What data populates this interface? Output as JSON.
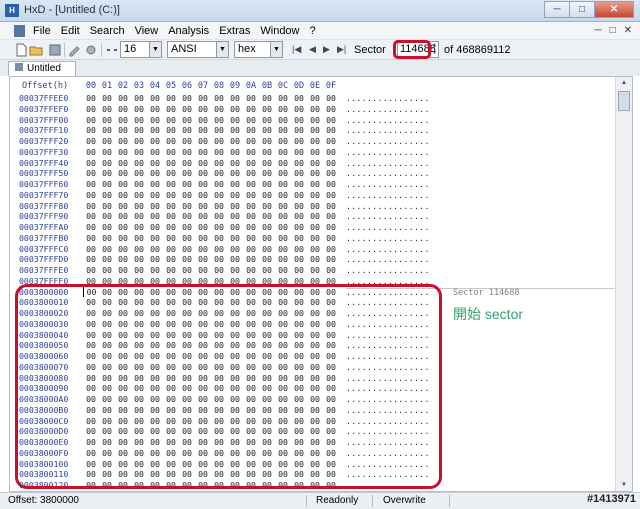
{
  "window": {
    "title": "HxD - [Untitled (C:)]",
    "controls": [
      "─",
      "□",
      "✕"
    ]
  },
  "menu": {
    "items": [
      "File",
      "Edit",
      "Search",
      "View",
      "Analysis",
      "Extras",
      "Window",
      "?"
    ],
    "mdi_controls": [
      "─",
      "□",
      "✕"
    ]
  },
  "toolbar": {
    "bytes_per_row": "16",
    "charset": "ANSI",
    "offset_base": "hex",
    "sector_label": "Sector",
    "sector_value": "114688",
    "sector_total": "of 468869112"
  },
  "tab": {
    "label": "Untitled (C:)"
  },
  "editor": {
    "offset_header": "Offset(h)",
    "column_headers": [
      "00",
      "01",
      "02",
      "03",
      "04",
      "05",
      "06",
      "07",
      "08",
      "09",
      "0A",
      "0B",
      "0C",
      "0D",
      "0E",
      "0F"
    ],
    "byte_value": "00",
    "ascii_value": "................",
    "rows": [
      "00037FFEE0",
      "00037FFEF0",
      "00037FFF00",
      "00037FFF10",
      "00037FFF20",
      "00037FFF30",
      "00037FFF40",
      "00037FFF50",
      "00037FFF60",
      "00037FFF70",
      "00037FFF80",
      "00037FFF90",
      "00037FFFA0",
      "00037FFFB0",
      "00037FFFC0",
      "00037FFFD0",
      "00037FFFE0",
      "00037FFFF0",
      "0003800000",
      "0003800010",
      "0003800020",
      "0003800030",
      "0003800040",
      "0003800050",
      "0003800060",
      "0003800070",
      "0003800080",
      "0003800090",
      "00038000A0",
      "00038000B0",
      "00038000C0",
      "00038000D0",
      "00038000E0",
      "00038000F0",
      "0003800100",
      "0003800110",
      "0003800120"
    ],
    "sector_note": "Sector 114688",
    "annotation": "開始 sector"
  },
  "status": {
    "offset": "Offset: 3800000",
    "mode": "Readonly",
    "insert_mode": "Overwrite"
  },
  "watermark": "#1413971"
}
